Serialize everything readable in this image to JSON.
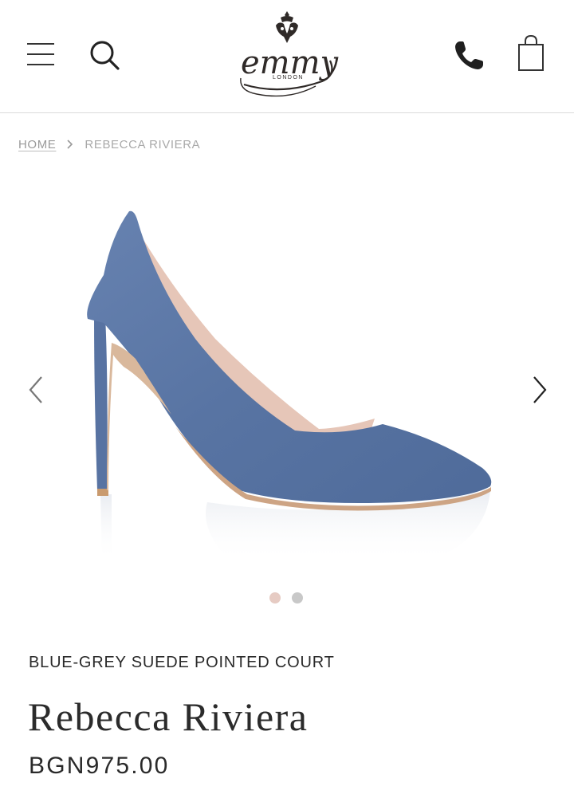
{
  "header": {
    "menu_icon": "hamburger-menu-icon",
    "search_icon": "search-icon",
    "logo_text": "emmy",
    "logo_subtext": "LONDON",
    "phone_icon": "phone-icon",
    "bag_icon": "shopping-bag-icon"
  },
  "breadcrumb": {
    "home": "HOME",
    "separator_icon": "chevron-right-icon",
    "current": "REBECCA RIVIERA"
  },
  "gallery": {
    "prev_icon": "chevron-left-icon",
    "next_icon": "chevron-right-icon",
    "image_alt": "Rebecca Riviera",
    "slides": 2,
    "active_slide": 1,
    "dot_colors": {
      "active": "#e6cbc3",
      "inactive": "#c8c8c8"
    }
  },
  "product": {
    "subtitle": "BLUE-GREY SUEDE POINTED COURT",
    "name": "Rebecca Riviera",
    "price": "BGN975.00"
  },
  "colors": {
    "shoe": "#5a76a4",
    "lining": "#e5c6b8",
    "text": "#2a2a2a",
    "muted": "#9a9a9a"
  }
}
